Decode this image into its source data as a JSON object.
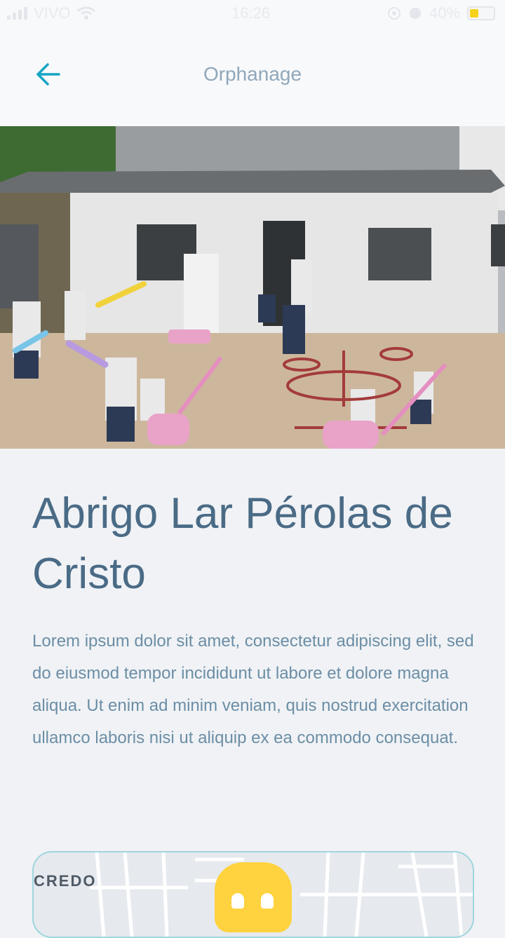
{
  "status_bar": {
    "carrier": "VIVO",
    "time": "16:26",
    "battery": "40%"
  },
  "header": {
    "title": "Orphanage"
  },
  "hero": {
    "alt": "Children playing outside the orphanage building"
  },
  "content": {
    "title": "Abrigo Lar Pérolas de Cristo",
    "description": "Lorem ipsum dolor sit amet, consectetur adipiscing elit, sed do eiusmod tempor incididunt ut labore et dolore magna aliqua. Ut enim ad minim veniam, quis nostrud exercitation ullamco laboris nisi ut aliquip ex ea commodo consequat."
  },
  "map": {
    "label": "CREDO"
  },
  "colors": {
    "accent": "#15a5c3",
    "title": "#4a6b86",
    "text": "#6b8ea6",
    "pin": "#ffd23f"
  }
}
